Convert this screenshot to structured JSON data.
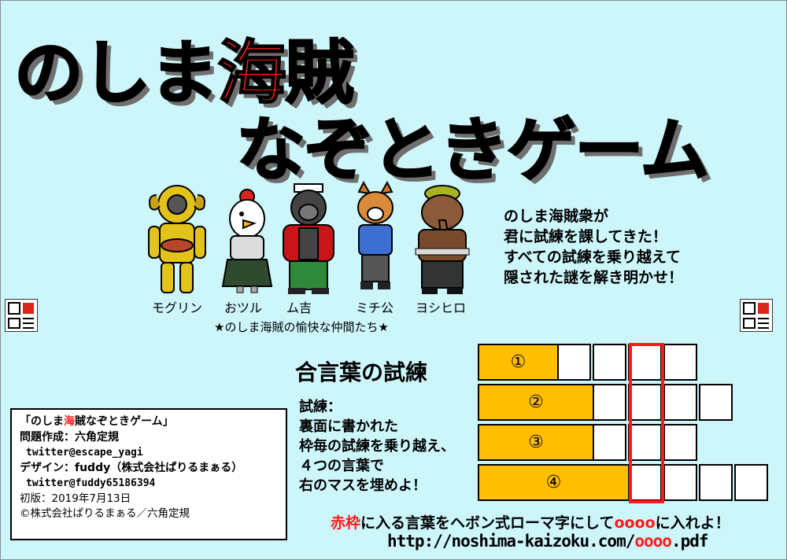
{
  "title": {
    "line1_pre": "のしま",
    "line1_red": "海",
    "line1_post": "賊",
    "line2": "なぞときゲーム"
  },
  "characters": [
    {
      "name": "モグリン",
      "icon": "diver-ram-icon"
    },
    {
      "name": "おツル",
      "icon": "crane-icon"
    },
    {
      "name": "ム吉",
      "icon": "gorilla-icon"
    },
    {
      "name": "ミチ公",
      "icon": "dog-icon"
    },
    {
      "name": "ヨシヒロ",
      "icon": "elephant-icon"
    }
  ],
  "caption": "★のしま海賊の愉快な仲間たち★",
  "intro": [
    "のしま海賊衆が",
    "君に試練を課してきた！",
    "すべての試練を乗り越えて",
    "隠された謎を解き明かせ！"
  ],
  "section_title": "合言葉の試練",
  "instructions": [
    "試練：",
    "裏面に書かれた",
    "枠毎の試練を乗り越え、",
    "４つの言葉で",
    "右のマスを埋めよ！"
  ],
  "puzzle": {
    "rows": [
      {
        "label": "①",
        "cells": 4
      },
      {
        "label": "②",
        "cells": 4
      },
      {
        "label": "③",
        "cells": 3
      },
      {
        "label": "④",
        "cells": 4
      }
    ]
  },
  "credits": {
    "title_open": "「のしま",
    "title_red": "海",
    "title_close": "賊なぞときゲーム」",
    "author": "問題作成：六角定規",
    "author_twitter": "twitter@escape_yagi",
    "design": "デザイン：fuddy（株式会社ぱりるまぁる）",
    "design_twitter": "twitter@fuddy65186394",
    "edition": "初版：2019年7月13日",
    "copyright": "©株式会社ぱりるまぁる／六角定規"
  },
  "hint": {
    "red_frame": "赤枠",
    "middle": "に入る言葉をヘボン式ローマ字にして",
    "placeholder": "oooo",
    "end": "に入れよ！"
  },
  "url": {
    "prefix": "http://noshima-kaizoku.com/",
    "placeholder": "oooo",
    "suffix": ".pdf"
  },
  "colors": {
    "background": "#cdf6fb",
    "accent_red": "#ff1a1a",
    "label_yellow": "#ffbf00"
  }
}
